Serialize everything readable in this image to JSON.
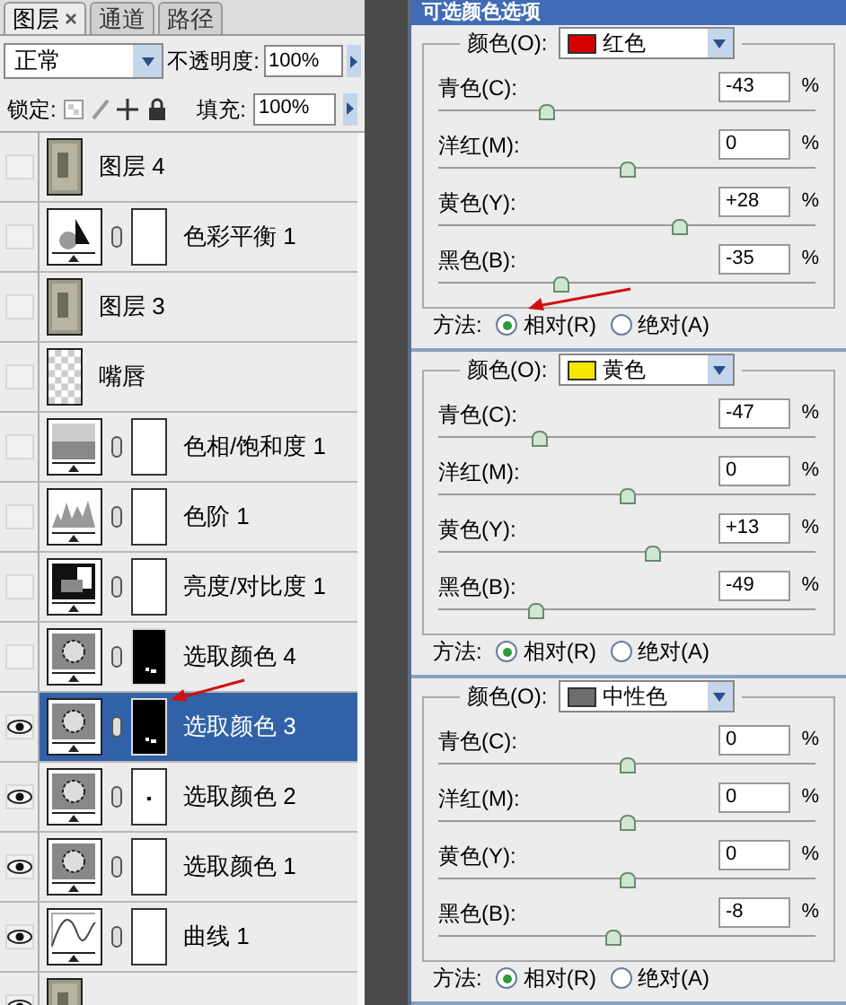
{
  "layers_panel": {
    "tabs": [
      {
        "label": "图层",
        "selected": true,
        "closable": true
      },
      {
        "label": "通道",
        "selected": false
      },
      {
        "label": "路径",
        "selected": false
      }
    ],
    "blend_mode": "正常",
    "opacity_label": "不透明度:",
    "opacity": "100%",
    "lock_label": "锁定:",
    "fill_label": "填充:",
    "fill": "100%",
    "layers": [
      {
        "name": "图层 4",
        "visible": false,
        "selected": false,
        "kind": "photo"
      },
      {
        "name": "色彩平衡 1",
        "visible": false,
        "selected": false,
        "kind": "balance",
        "mask": {
          "kind": "white"
        }
      },
      {
        "name": "图层 3",
        "visible": false,
        "selected": false,
        "kind": "photo"
      },
      {
        "name": "嘴唇",
        "visible": false,
        "selected": false,
        "kind": "transparent"
      },
      {
        "name": "色相/饱和度 1",
        "visible": false,
        "selected": false,
        "kind": "hue",
        "mask": {
          "kind": "white"
        }
      },
      {
        "name": "色阶 1",
        "visible": false,
        "selected": false,
        "kind": "levels",
        "mask": {
          "kind": "white"
        }
      },
      {
        "name": "亮度/对比度 1",
        "visible": false,
        "selected": false,
        "kind": "brightness",
        "mask": {
          "kind": "white"
        }
      },
      {
        "name": "选取颜色 4",
        "visible": false,
        "selected": false,
        "kind": "selective",
        "mask": {
          "kind": "black"
        }
      },
      {
        "name": "选取颜色 3",
        "visible": true,
        "selected": true,
        "kind": "selective",
        "mask": {
          "kind": "black"
        }
      },
      {
        "name": "选取颜色 2",
        "visible": true,
        "selected": false,
        "kind": "selective",
        "mask": {
          "kind": "dot"
        }
      },
      {
        "name": "选取颜色 1",
        "visible": true,
        "selected": false,
        "kind": "selective",
        "mask": {
          "kind": "white"
        }
      },
      {
        "name": "曲线 1",
        "visible": true,
        "selected": false,
        "kind": "curves",
        "mask": {
          "kind": "white"
        }
      },
      {
        "visible": true,
        "selected": false,
        "kind": "photo"
      }
    ]
  },
  "dialog": {
    "title": "可选颜色选项",
    "sections": [
      {
        "color_label": "颜色(O):",
        "color_name": "红色",
        "color": "#d40000",
        "sliders": [
          {
            "label": "青色(C):",
            "value": "-43",
            "unit": "%",
            "level": 0.285
          },
          {
            "label": "洋红(M):",
            "value": "0",
            "unit": "%",
            "level": 0.5
          },
          {
            "label": "黄色(Y):",
            "value": "+28",
            "unit": "%",
            "level": 0.64
          },
          {
            "label": "黑色(B):",
            "value": "-35",
            "unit": "%",
            "level": 0.325
          }
        ],
        "method_label": "方法:",
        "options": [
          {
            "label": "相对(R)",
            "selected": true
          },
          {
            "label": "绝对(A)",
            "selected": false
          }
        ]
      },
      {
        "color_label": "颜色(O):",
        "color_name": "黄色",
        "color": "#f5e600",
        "sliders": [
          {
            "label": "青色(C):",
            "value": "-47",
            "unit": "%",
            "level": 0.265
          },
          {
            "label": "洋红(M):",
            "value": "0",
            "unit": "%",
            "level": 0.5
          },
          {
            "label": "黄色(Y):",
            "value": "+13",
            "unit": "%",
            "level": 0.565
          },
          {
            "label": "黑色(B):",
            "value": "-49",
            "unit": "%",
            "level": 0.255
          }
        ],
        "method_label": "方法:",
        "options": [
          {
            "label": "相对(R)",
            "selected": true
          },
          {
            "label": "绝对(A)",
            "selected": false
          }
        ]
      },
      {
        "color_label": "颜色(O):",
        "color_name": "中性色",
        "color": "#6e6e6e",
        "sliders": [
          {
            "label": "青色(C):",
            "value": "0",
            "unit": "%",
            "level": 0.5
          },
          {
            "label": "洋红(M):",
            "value": "0",
            "unit": "%",
            "level": 0.5
          },
          {
            "label": "黄色(Y):",
            "value": "0",
            "unit": "%",
            "level": 0.5
          },
          {
            "label": "黑色(B):",
            "value": "-8",
            "unit": "%",
            "level": 0.46
          }
        ],
        "method_label": "方法:",
        "options": [
          {
            "label": "相对(R)",
            "selected": true
          },
          {
            "label": "绝对(A)",
            "selected": false
          }
        ]
      }
    ]
  }
}
